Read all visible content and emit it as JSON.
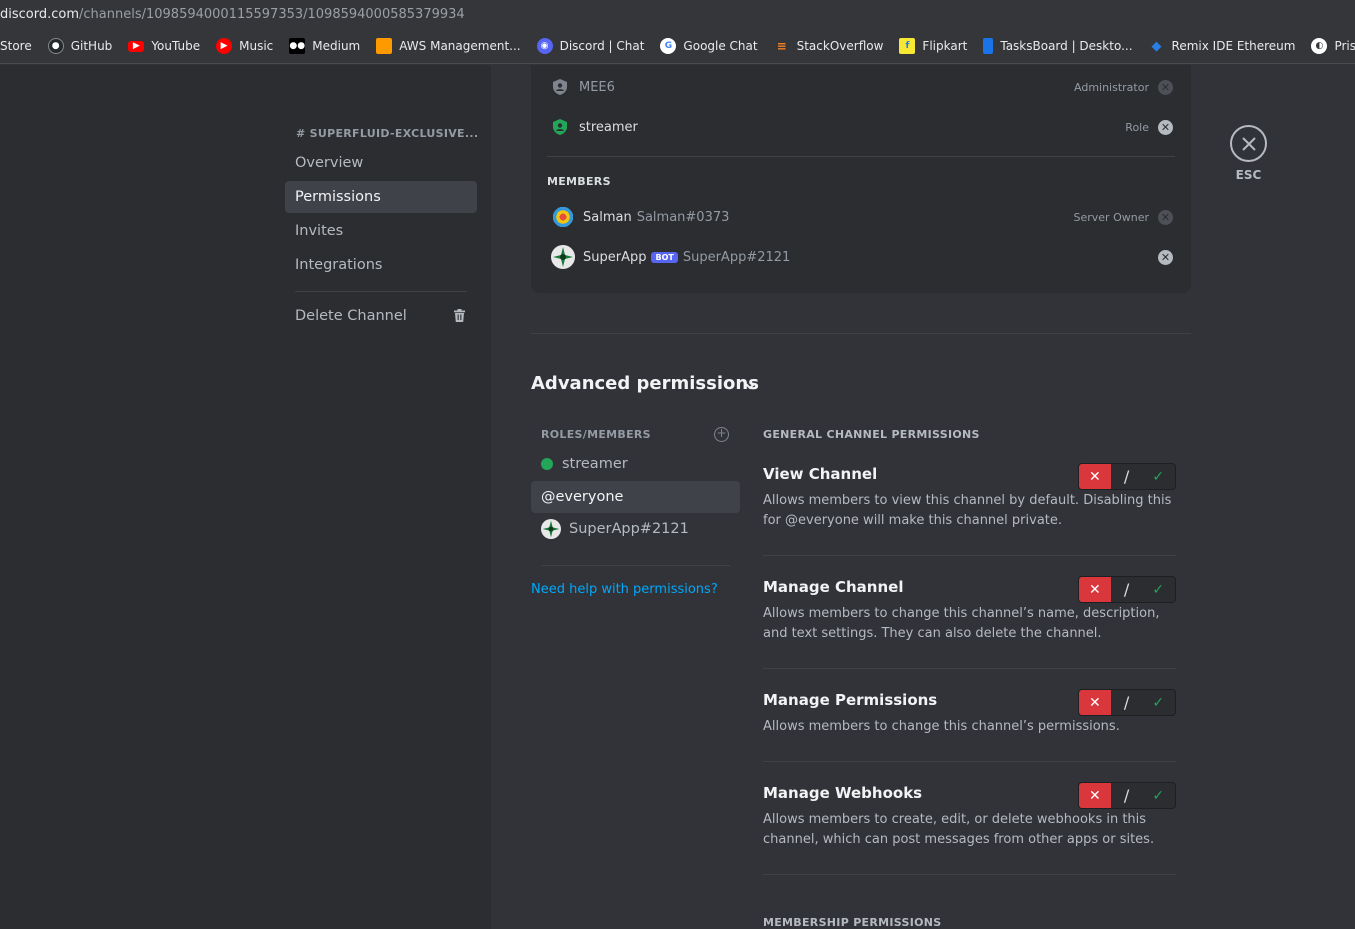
{
  "browser": {
    "url_domain": "discord.com",
    "url_path": "/channels/1098594000115597353/1098594000585379934",
    "bookmarks": [
      {
        "label": "Store",
        "icon": "store-icon",
        "color": ""
      },
      {
        "label": "GitHub",
        "icon": "github-icon",
        "color": "#24292e"
      },
      {
        "label": "YouTube",
        "icon": "youtube-icon",
        "color": "#ff0000"
      },
      {
        "label": "Music",
        "icon": "youtube-music-icon",
        "color": "#ff0000"
      },
      {
        "label": "Medium",
        "icon": "medium-icon",
        "color": "#000000"
      },
      {
        "label": "AWS Management...",
        "icon": "aws-icon",
        "color": "#ff9900"
      },
      {
        "label": "Discord | Chat",
        "icon": "discord-icon",
        "color": "#5865f2"
      },
      {
        "label": "Google Chat",
        "icon": "google-icon",
        "color": "#ffffff"
      },
      {
        "label": "StackOverflow",
        "icon": "stackoverflow-icon",
        "color": "#f48024"
      },
      {
        "label": "Flipkart",
        "icon": "flipkart-icon",
        "color": "#f8e831"
      },
      {
        "label": "TasksBoard | Deskto...",
        "icon": "tasksboard-icon",
        "color": "#1a73e8"
      },
      {
        "label": "Remix IDE Ethereum",
        "icon": "remix-icon",
        "color": "#2a7de1"
      },
      {
        "label": "Prisma ERD",
        "icon": "prisma-icon",
        "color": "#ffffff"
      }
    ]
  },
  "sidebar": {
    "header": "# SUPERFLUID-EXCLUSIVE...",
    "items": [
      {
        "label": "Overview"
      },
      {
        "label": "Permissions"
      },
      {
        "label": "Invites"
      },
      {
        "label": "Integrations"
      }
    ],
    "delete_label": "Delete Channel"
  },
  "close": {
    "label": "ESC"
  },
  "card": {
    "roles": [
      {
        "name": "MEE6",
        "right": "Administrator"
      },
      {
        "name": "streamer",
        "right": "Role"
      }
    ],
    "members_label": "MEMBERS",
    "members": [
      {
        "name": "Salman",
        "tag": "Salman#0373",
        "right": "Server Owner",
        "badge": ""
      },
      {
        "name": "SuperApp",
        "tag": "SuperApp#2121",
        "right": "",
        "badge": "BOT"
      }
    ]
  },
  "advanced": {
    "title": "Advanced permissions",
    "roles_header": "ROLES/MEMBERS",
    "roles": [
      {
        "label": "streamer"
      },
      {
        "label": "@everyone"
      },
      {
        "label": "SuperApp#2121"
      }
    ],
    "help_link": "Need help with permissions?",
    "section_header": "GENERAL CHANNEL PERMISSIONS",
    "permissions": [
      {
        "title": "View Channel",
        "desc": "Allows members to view this channel by default. Disabling this for @everyone will make this channel private.",
        "state": "deny"
      },
      {
        "title": "Manage Channel",
        "desc": "Allows members to change this channel’s name, description, and text settings. They can also delete the channel.",
        "state": "deny"
      },
      {
        "title": "Manage Permissions",
        "desc": "Allows members to change this channel’s permissions.",
        "state": "deny"
      },
      {
        "title": "Manage Webhooks",
        "desc": "Allows members to create, edit, or delete webhooks in this channel, which can post messages from other apps or sites.",
        "state": "deny"
      }
    ],
    "membership_header": "MEMBERSHIP PERMISSIONS"
  }
}
